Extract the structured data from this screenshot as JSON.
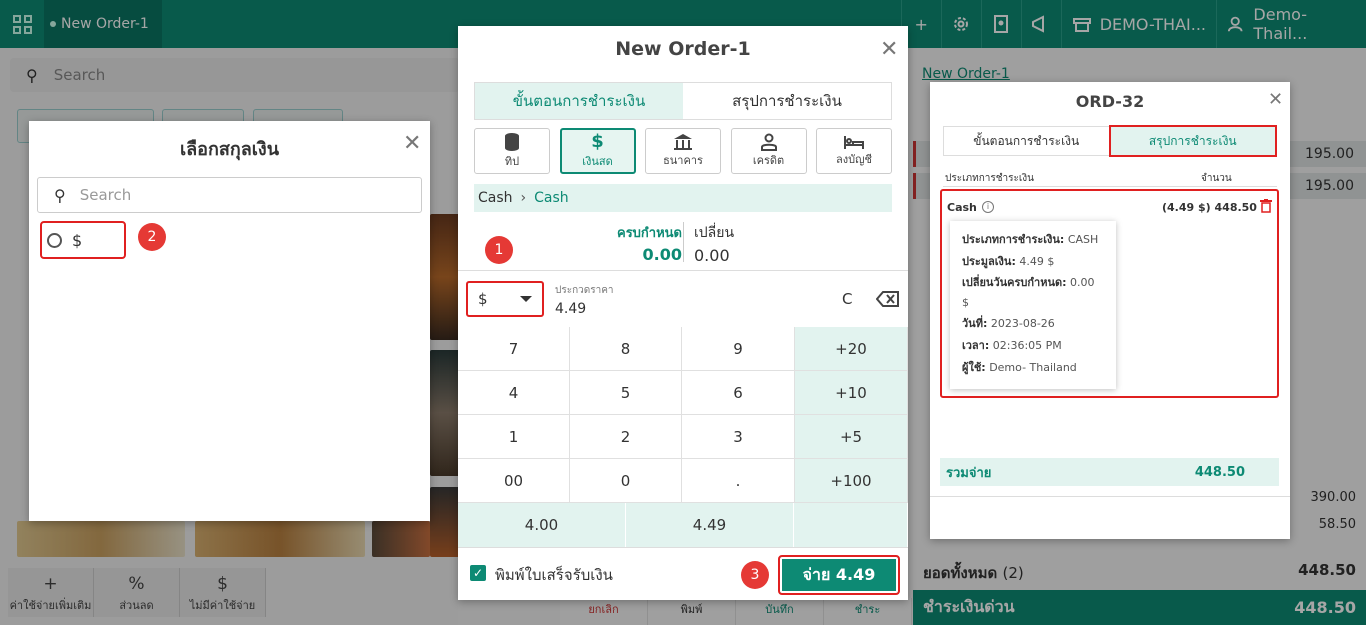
{
  "topbar": {
    "order_tab": "New Order-1",
    "store": "DEMO-THAI...",
    "user": "Demo- Thail..."
  },
  "background": {
    "search_placeholder": "Search",
    "tools": [
      {
        "icon": "+",
        "label": "ค่าใช้จ่ายเพิ่มเติม"
      },
      {
        "icon": "%",
        "label": "ส่วนลด"
      },
      {
        "icon": "$",
        "label": "ไม่มีค่าใช้จ่าย"
      }
    ],
    "order_link": "New Order-1",
    "row_amount_1": "195.00",
    "row_amount_2": "195.00",
    "subtotal": "390.00",
    "tax": "58.50",
    "total_label": "ยอดทั้งหมด",
    "total_count": "(2)",
    "total_value": "448.50",
    "quickpay_label": "ชำระเงินด่วน",
    "quickpay_value": "448.50",
    "actions": [
      "ยกเลิก",
      "พิมพ์",
      "บันทึก",
      "ชำระ"
    ]
  },
  "currency_modal": {
    "title": "เลือกสกุลเงิน",
    "search_placeholder": "Search",
    "option": "$"
  },
  "steps": [
    "1",
    "2",
    "3"
  ],
  "payment_modal": {
    "title": "New Order-1",
    "tabs": [
      "ขั้นตอนการชำระเงิน",
      "สรุปการชำระเงิน"
    ],
    "methods": [
      {
        "icon": "coins-icon",
        "label": "ทิป"
      },
      {
        "icon": "$",
        "label": "เงินสด"
      },
      {
        "icon": "bank-icon",
        "label": "ธนาคาร"
      },
      {
        "icon": "user-icon",
        "label": "เครดิต"
      },
      {
        "icon": "bed-icon",
        "label": "ลงบัญชี"
      }
    ],
    "breadcrumb": [
      "Cash",
      "Cash"
    ],
    "due_label": "ครบกำหนด",
    "due_value": "0.00",
    "change_label": "เปลี่ยน",
    "change_value": "0.00",
    "currency": "$",
    "amount_label": "ประกวดราคา",
    "amount_value": "4.49",
    "clear_label": "C",
    "keypad": [
      "7",
      "8",
      "9",
      "+20",
      "4",
      "5",
      "6",
      "+10",
      "1",
      "2",
      "3",
      "+5",
      "00",
      "0",
      ".",
      "+100"
    ],
    "quick_amounts": [
      "4.00",
      "4.49",
      ""
    ],
    "print_label": "พิมพ์ใบเสร็จรับเงิน",
    "pay_button": "จ่าย 4.49"
  },
  "receipt_modal": {
    "title": "ORD-32",
    "tabs": [
      "ขั้นตอนการชำระเงิน",
      "สรุปการชำระเงิน"
    ],
    "col_type": "ประเภทการชำระเงิน",
    "col_amount": "จำนวน",
    "item_name": "Cash",
    "item_amount": "(4.49 $)  448.50",
    "tooltip": [
      {
        "k": "ประเภทการชำระเงิน:",
        "v": "CASH"
      },
      {
        "k": "ประมูลเงิน:",
        "v": "4.49 $"
      },
      {
        "k": "เปลี่ยนวันครบกำหนด:",
        "v": "0.00 $"
      },
      {
        "k": "วันที่:",
        "v": "2023-08-26"
      },
      {
        "k": "เวลา:",
        "v": "02:36:05 PM"
      },
      {
        "k": "ผู้ใช้:",
        "v": "Demo- Thailand"
      }
    ],
    "total_label": "รวมจ่าย",
    "total_value": "448.50"
  },
  "colors": {
    "accent": "#0d8a74",
    "highlight": "#e02020"
  }
}
